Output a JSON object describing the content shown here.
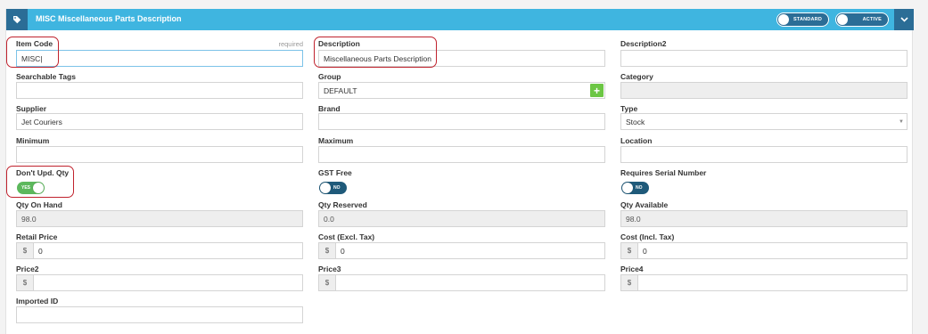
{
  "header": {
    "title": "MISC Miscellaneous Parts Description",
    "toggle_standard": "STANDARD",
    "toggle_active": "ACTIVE",
    "accent": "#3fb5e0",
    "dark": "#2b6d96"
  },
  "fields": {
    "item_code": {
      "label": "Item Code",
      "required": "required",
      "value": "MISC|"
    },
    "description": {
      "label": "Description",
      "value": "Miscellaneous Parts Description"
    },
    "description2": {
      "label": "Description2",
      "value": ""
    },
    "searchable_tags": {
      "label": "Searchable Tags",
      "value": ""
    },
    "group": {
      "label": "Group",
      "value": "DEFAULT",
      "add": "+"
    },
    "category": {
      "label": "Category",
      "value": ""
    },
    "supplier": {
      "label": "Supplier",
      "value": "Jet Couriers"
    },
    "brand": {
      "label": "Brand",
      "value": ""
    },
    "type": {
      "label": "Type",
      "value": "Stock",
      "caret": "▼"
    },
    "minimum": {
      "label": "Minimum",
      "value": ""
    },
    "maximum": {
      "label": "Maximum",
      "value": ""
    },
    "location": {
      "label": "Location",
      "value": ""
    },
    "dont_upd_qty": {
      "label": "Don't Upd. Qty",
      "state": "YES"
    },
    "gst_free": {
      "label": "GST Free",
      "state": "NO"
    },
    "requires_serial": {
      "label": "Requires Serial Number",
      "state": "NO"
    },
    "qty_on_hand": {
      "label": "Qty On Hand",
      "value": "98.0"
    },
    "qty_reserved": {
      "label": "Qty Reserved",
      "value": "0.0"
    },
    "qty_available": {
      "label": "Qty Available",
      "value": "98.0"
    },
    "retail_price": {
      "label": "Retail Price",
      "prefix": "$",
      "value": "0"
    },
    "cost_excl": {
      "label": "Cost (Excl. Tax)",
      "prefix": "$",
      "value": "0"
    },
    "cost_incl": {
      "label": "Cost (Incl. Tax)",
      "prefix": "$",
      "value": "0"
    },
    "price2": {
      "label": "Price2",
      "prefix": "$",
      "value": ""
    },
    "price3": {
      "label": "Price3",
      "prefix": "$",
      "value": ""
    },
    "price4": {
      "label": "Price4",
      "prefix": "$",
      "value": ""
    },
    "imported_id": {
      "label": "Imported ID",
      "value": ""
    }
  },
  "highlight_color": "#c0222d"
}
